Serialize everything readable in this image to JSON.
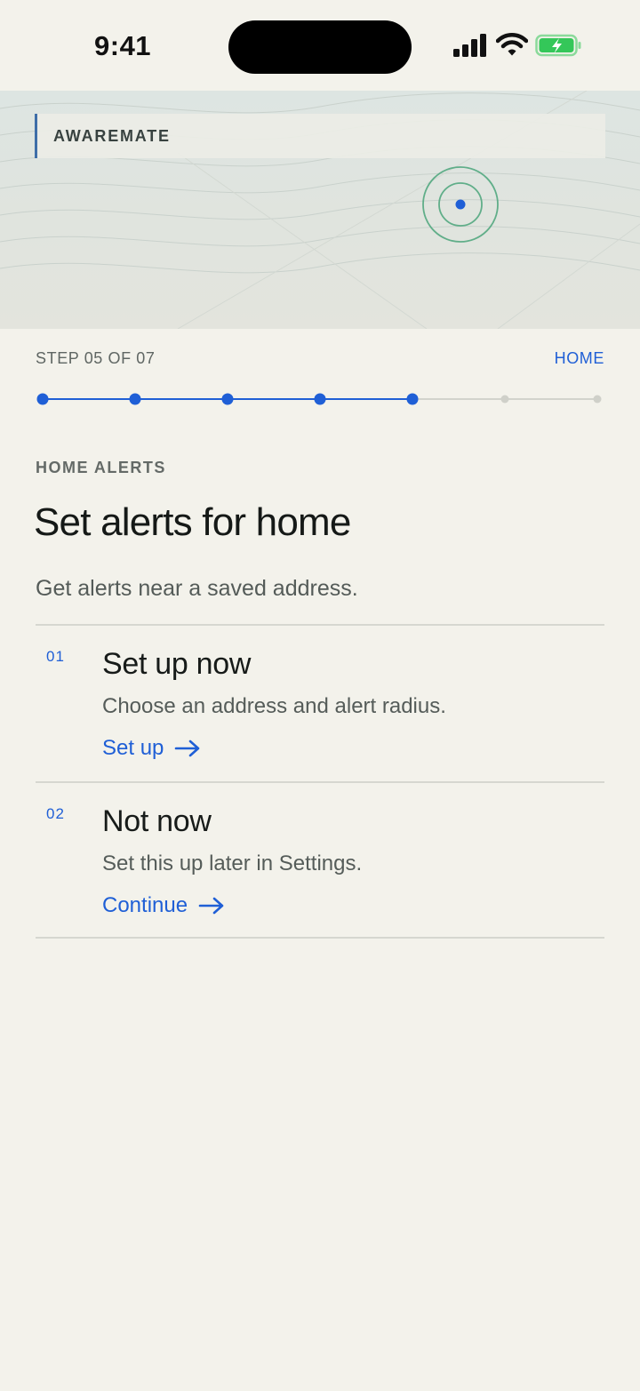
{
  "status_bar": {
    "time": "9:41"
  },
  "brand": {
    "name": "AWAREMATE"
  },
  "step": {
    "label": "STEP 05 OF 07",
    "context": "HOME",
    "current": 5,
    "total": 7
  },
  "header": {
    "eyebrow": "HOME ALERTS",
    "title": "Set alerts for home",
    "subtitle": "Get alerts near a saved address."
  },
  "options": [
    {
      "number": "01",
      "title": "Set up now",
      "description": "Choose an address and alert radius.",
      "link_label": "Set up"
    },
    {
      "number": "02",
      "title": "Not now",
      "description": "Set this up later in Settings.",
      "link_label": "Continue"
    }
  ],
  "colors": {
    "accent": "#1f5fd6",
    "background": "#f3f2eb",
    "radius_ring": "#4aa57a",
    "battery_fill": "#34c759"
  },
  "icons": [
    "signal-icon",
    "wifi-icon",
    "battery-charging-icon",
    "location-marker-icon",
    "arrow-right-icon"
  ]
}
